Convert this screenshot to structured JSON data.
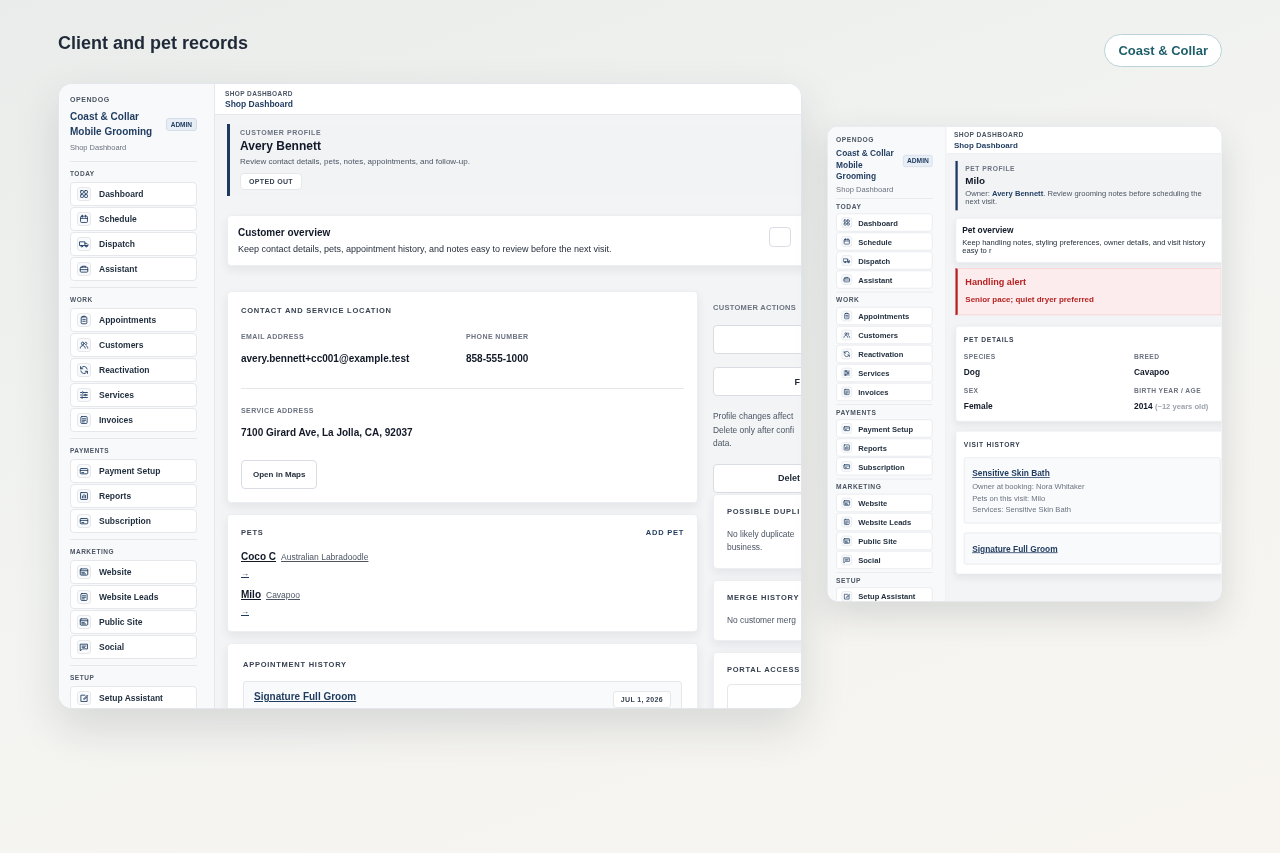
{
  "page": {
    "title": "Client and pet records",
    "brand_button": "Coast & Collar"
  },
  "windows": [
    {
      "kind": "customer_profile",
      "sidebar": {
        "org": "OPENDOG",
        "business": "Coast & Collar Mobile Grooming",
        "role_badge": "ADMIN",
        "subtitle": "Shop Dashboard",
        "sections": [
          {
            "label": "TODAY",
            "items": [
              "Dashboard",
              "Schedule",
              "Dispatch",
              "Assistant"
            ]
          },
          {
            "label": "WORK",
            "items": [
              "Appointments",
              "Customers",
              "Reactivation",
              "Services",
              "Invoices"
            ]
          },
          {
            "label": "PAYMENTS",
            "items": [
              "Payment Setup",
              "Reports",
              "Subscription"
            ]
          },
          {
            "label": "MARKETING",
            "items": [
              "Website",
              "Website Leads",
              "Public Site",
              "Social"
            ]
          },
          {
            "label": "SETUP",
            "items": [
              "Setup Assistant"
            ]
          }
        ]
      },
      "topbar": {
        "label": "SHOP DASHBOARD",
        "title": "Shop Dashboard"
      },
      "header": {
        "eyebrow": "CUSTOMER PROFILE",
        "name": "Avery Bennett",
        "description": "Review contact details, pets, notes, appointments, and follow-up.",
        "status_chip": "OPTED OUT"
      },
      "overview": {
        "title": "Customer overview",
        "description": "Keep contact details, pets, appointment history, and notes easy to review before the next visit."
      },
      "contact": {
        "heading": "CONTACT AND SERVICE LOCATION",
        "email_label": "EMAIL ADDRESS",
        "email": "avery.bennett+cc001@example.test",
        "phone_label": "PHONE NUMBER",
        "phone": "858-555-1000",
        "address_label": "SERVICE ADDRESS",
        "address": "7100 Girard Ave, La Jolla, CA, 92037",
        "maps_button": "Open in Maps"
      },
      "pets": {
        "heading": "PETS",
        "add_button": "ADD PET",
        "items": [
          {
            "name": "Coco C",
            "breed": "Australian Labradoodle",
            "link": "→"
          },
          {
            "name": "Milo",
            "breed": "Cavapoo",
            "link": "→"
          }
        ]
      },
      "appointments": {
        "heading": "APPOINTMENT HISTORY",
        "items": [
          {
            "service": "Signature Full Groom",
            "date": "JUL 1, 2026"
          }
        ]
      },
      "actions": {
        "heading": "CUSTOMER ACTIONS",
        "button": "F",
        "notice": [
          "Profile changes affect",
          "Delete only after confi",
          "data."
        ],
        "delete_button": "Delet"
      },
      "side_cards": [
        {
          "heading": "POSSIBLE DUPLI",
          "lines": [
            "No likely duplicate",
            "business."
          ]
        },
        {
          "heading": "MERGE HISTORY",
          "lines": [
            "No customer merg"
          ]
        },
        {
          "heading": "PORTAL ACCESS"
        }
      ]
    },
    {
      "kind": "pet_profile",
      "sidebar": {
        "org": "OPENDOG",
        "business": "Coast & Collar Mobile Grooming",
        "role_badge": "ADMIN",
        "subtitle": "Shop Dashboard",
        "sections": [
          {
            "label": "TODAY",
            "items": [
              "Dashboard",
              "Schedule",
              "Dispatch",
              "Assistant"
            ]
          },
          {
            "label": "WORK",
            "items": [
              "Appointments",
              "Customers",
              "Reactivation",
              "Services",
              "Invoices"
            ]
          },
          {
            "label": "PAYMENTS",
            "items": [
              "Payment Setup",
              "Reports",
              "Subscription"
            ]
          },
          {
            "label": "MARKETING",
            "items": [
              "Website",
              "Website Leads",
              "Public Site",
              "Social"
            ]
          },
          {
            "label": "SETUP",
            "items": [
              "Setup Assistant"
            ]
          }
        ]
      },
      "topbar": {
        "label": "SHOP DASHBOARD",
        "title": "Shop Dashboard"
      },
      "header": {
        "eyebrow": "PET PROFILE",
        "name": "Milo",
        "owner_line": "Owner: **Avery Bennett**. Review grooming notes before scheduling the next visit."
      },
      "overview": {
        "title": "Pet overview",
        "description": "Keep handling notes, styling preferences, owner details, and visit history easy to r"
      },
      "alert": {
        "title": "Handling alert",
        "text": "Senior pace; quiet dryer preferred"
      },
      "details": {
        "heading": "PET DETAILS",
        "fields": [
          {
            "label": "SPECIES",
            "value": "Dog"
          },
          {
            "label": "BREED",
            "value": "Cavapoo"
          },
          {
            "label": "SEX",
            "value": "Female"
          },
          {
            "label": "BIRTH YEAR / AGE",
            "value": "2014",
            "note": "(~12 years old)"
          }
        ]
      },
      "visits": {
        "heading": "VISIT HISTORY",
        "items": [
          {
            "service": "Sensitive Skin Bath",
            "lines": [
              "Owner at booking: Nora Whitaker",
              "Pets on this visit: Milo",
              "Services: Sensitive Skin Bath"
            ]
          },
          {
            "service": "Signature Full Groom"
          }
        ]
      }
    }
  ]
}
